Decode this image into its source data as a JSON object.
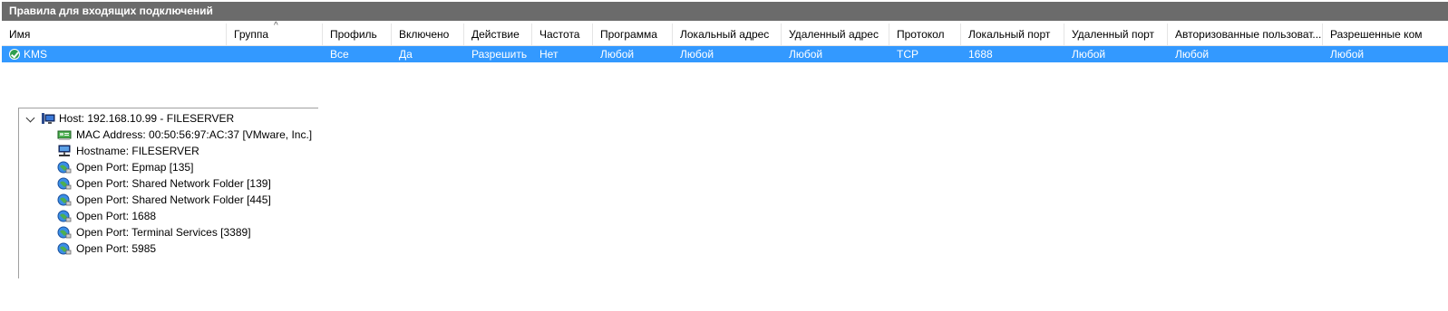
{
  "rules_pane": {
    "title": "Правила для входящих подключений",
    "columns": [
      "Имя",
      "Группа",
      "Профиль",
      "Включено",
      "Действие",
      "Частота",
      "Программа",
      "Локальный адрес",
      "Удаленный адрес",
      "Протокол",
      "Локальный порт",
      "Удаленный порт",
      "Авторизованные пользоват...",
      "Разрешенные ком"
    ],
    "sort_indicator": "^",
    "rows": [
      {
        "name": "KMS",
        "group": "",
        "profile": "Все",
        "enabled": "Да",
        "action": "Разрешить",
        "override": "Нет",
        "program": "Любой",
        "local_address": "Любой",
        "remote_address": "Любой",
        "protocol": "TCP",
        "local_port": "1688",
        "remote_port": "Любой",
        "authorized_users": "Любой",
        "allowed_computers": "Любой",
        "status_icon": "allow-check-icon"
      }
    ],
    "colors": {
      "title_bg": "#6b6b6b",
      "selected_row_bg": "#3399ff"
    }
  },
  "scan_tree": {
    "host": {
      "label": "Host: 192.168.10.99 - FILESERVER",
      "icon": "host-computer-icon",
      "expanded": true
    },
    "children": [
      {
        "label": "MAC Address: 00:50:56:97:AC:37 [VMware, Inc.]",
        "icon": "network-card-icon"
      },
      {
        "label": "Hostname: FILESERVER",
        "icon": "hostname-network-icon"
      },
      {
        "label": "Open Port: Epmap [135]",
        "icon": "globe-port-icon"
      },
      {
        "label": "Open Port: Shared Network Folder [139]",
        "icon": "globe-port-icon"
      },
      {
        "label": "Open Port: Shared Network Folder [445]",
        "icon": "globe-port-icon"
      },
      {
        "label": "Open Port: 1688",
        "icon": "globe-port-icon"
      },
      {
        "label": "Open Port: Terminal Services [3389]",
        "icon": "globe-port-icon"
      },
      {
        "label": "Open Port: 5985",
        "icon": "globe-port-icon"
      }
    ]
  }
}
